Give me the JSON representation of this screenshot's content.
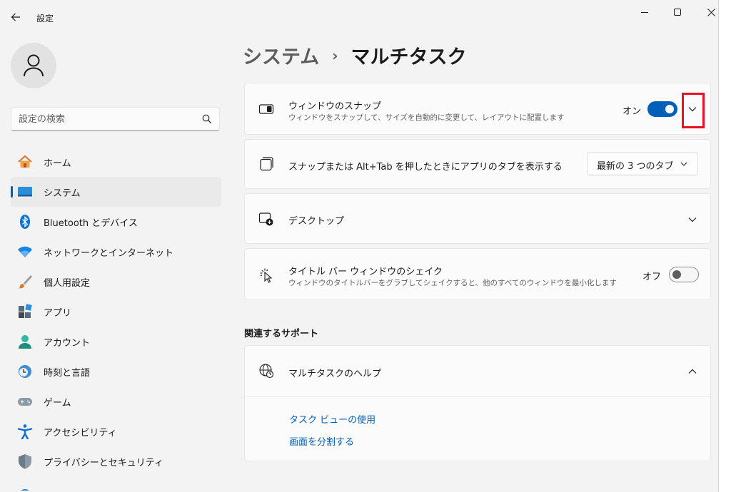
{
  "window": {
    "title": "設定"
  },
  "sidebar": {
    "search_placeholder": "設定の検索",
    "items": [
      {
        "label": "ホーム",
        "icon": "home-icon"
      },
      {
        "label": "システム",
        "icon": "system-icon",
        "active": true
      },
      {
        "label": "Bluetooth とデバイス",
        "icon": "bluetooth-icon"
      },
      {
        "label": "ネットワークとインターネット",
        "icon": "wifi-icon"
      },
      {
        "label": "個人用設定",
        "icon": "brush-icon"
      },
      {
        "label": "アプリ",
        "icon": "apps-icon"
      },
      {
        "label": "アカウント",
        "icon": "account-icon"
      },
      {
        "label": "時刻と言語",
        "icon": "time-language-icon"
      },
      {
        "label": "ゲーム",
        "icon": "gamepad-icon"
      },
      {
        "label": "アクセシビリティ",
        "icon": "accessibility-icon"
      },
      {
        "label": "プライバシーとセキュリティ",
        "icon": "shield-icon"
      }
    ]
  },
  "breadcrumb": {
    "parent": "システム",
    "separator": "›",
    "current": "マルチタスク"
  },
  "settings": {
    "snap": {
      "title": "ウィンドウのスナップ",
      "description": "ウィンドウをスナップして、サイズを自動的に変更して、レイアウトに配置します",
      "toggle_label": "オン",
      "toggle_on": true
    },
    "snap_tabs": {
      "title": "スナップまたは Alt+Tab を押したときにアプリのタブを表示する",
      "dropdown_value": "最新の 3 つのタブ"
    },
    "desktops": {
      "title": "デスクトップ"
    },
    "shake": {
      "title": "タイトル バー ウィンドウのシェイク",
      "description": "ウィンドウのタイトルバーをグラブしてシェイクすると、他のすべてのウィンドウを最小化します",
      "toggle_label": "オフ",
      "toggle_on": false
    }
  },
  "related_support": {
    "section_title": "関連するサポート",
    "help_title": "マルチタスクのヘルプ",
    "links": [
      "タスク ビューの使用",
      "画面を分割する"
    ]
  },
  "colors": {
    "accent": "#005fb8",
    "highlight": "#e81123"
  }
}
